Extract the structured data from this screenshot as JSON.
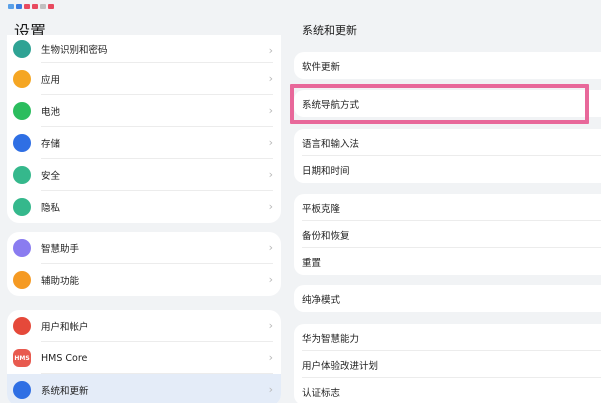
{
  "left": {
    "title": "设置",
    "groups": [
      [
        {
          "label": "生物识别和密码",
          "icon": "key-icon",
          "color": "#2fa394"
        },
        {
          "label": "应用",
          "icon": "apps-icon",
          "color": "#f5a623"
        },
        {
          "label": "电池",
          "icon": "battery-icon",
          "color": "#2bbd5e"
        },
        {
          "label": "存储",
          "icon": "storage-icon",
          "color": "#2f6fe4"
        },
        {
          "label": "安全",
          "icon": "shield-icon",
          "color": "#35b88c"
        },
        {
          "label": "隐私",
          "icon": "privacy-icon",
          "color": "#35b88c"
        }
      ],
      [
        {
          "label": "智慧助手",
          "icon": "assistant-icon",
          "color": "#8a7cf0"
        },
        {
          "label": "辅助功能",
          "icon": "accessibility-icon",
          "color": "#f59a23"
        }
      ],
      [
        {
          "label": "用户和帐户",
          "icon": "user-icon",
          "color": "#e5493a"
        },
        {
          "label": "HMS Core",
          "icon": "hms-icon",
          "color": "#e85a4f"
        },
        {
          "label": "系统和更新",
          "icon": "gear-icon",
          "color": "#2f6fe4"
        }
      ]
    ]
  },
  "right": {
    "title": "系统和更新",
    "groups": [
      [
        "软件更新"
      ],
      [
        "系统导航方式"
      ],
      [
        "语言和输入法",
        "日期和时间"
      ],
      [
        "平板克隆",
        "备份和恢复",
        "重置"
      ],
      [
        "纯净模式"
      ],
      [
        "华为智慧能力",
        "用户体验改进计划",
        "认证标志"
      ]
    ]
  },
  "icon_glyphs": {
    "hms_text": "HMS"
  }
}
